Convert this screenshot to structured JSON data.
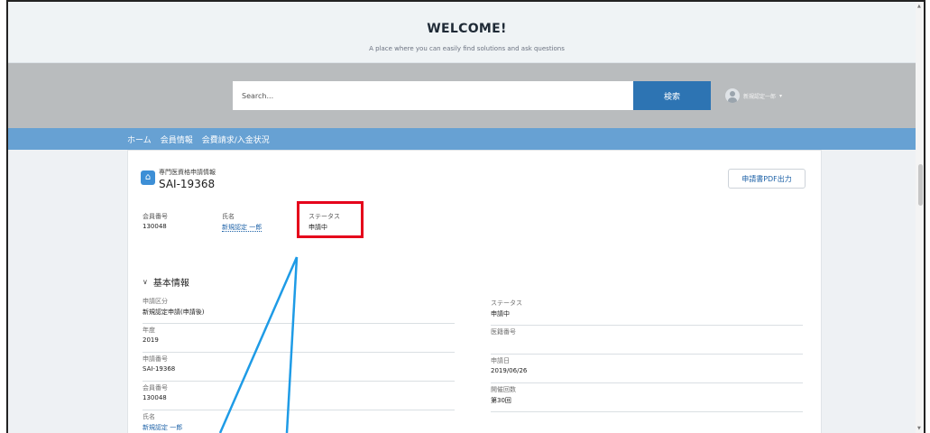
{
  "welcome": {
    "title": "WELCOME!",
    "subtitle": "A place where you can easily find solutions and ask questions"
  },
  "search": {
    "placeholder": "Search...",
    "button_label": "検索"
  },
  "user": {
    "name": "新規認定一郎",
    "caret": "▾"
  },
  "nav": {
    "items": [
      {
        "label": "ホーム"
      },
      {
        "label": "会員情報"
      },
      {
        "label": "会費請求/入金状況"
      }
    ]
  },
  "record": {
    "type_label": "専門医資格申請情報",
    "id": "SAI-19368",
    "pdf_button": "申請書PDF出力",
    "icon_glyph": "⌂"
  },
  "highlights": {
    "member_no_label": "会員番号",
    "member_no_value": "130048",
    "name_label": "氏名",
    "name_value": "新規認定 一郎",
    "status_label": "ステータス",
    "status_value": "申請中"
  },
  "section": {
    "chevron": "∨",
    "title": "基本情報"
  },
  "fields_left": [
    {
      "label": "申請区分",
      "value": "新規認定申請(申請後)"
    },
    {
      "label": "年度",
      "value": "2019"
    },
    {
      "label": "申請番号",
      "value": "SAI-19368"
    },
    {
      "label": "会員番号",
      "value": "130048"
    },
    {
      "label": "氏名",
      "value": "新規認定 一郎"
    }
  ],
  "fields_right": [
    {
      "label": "ステータス",
      "value": "申請中"
    },
    {
      "label": "医籍番号",
      "value": ""
    },
    {
      "label": "申請日",
      "value": "2019/06/26"
    },
    {
      "label": "開催回数",
      "value": "第30回"
    }
  ],
  "colors": {
    "search_button": "#2d74b3",
    "nav_bar": "#67a1d3",
    "highlight_box": "#e5001b",
    "pointer_lines": "#1e9be6",
    "link": "#1f63a8"
  }
}
